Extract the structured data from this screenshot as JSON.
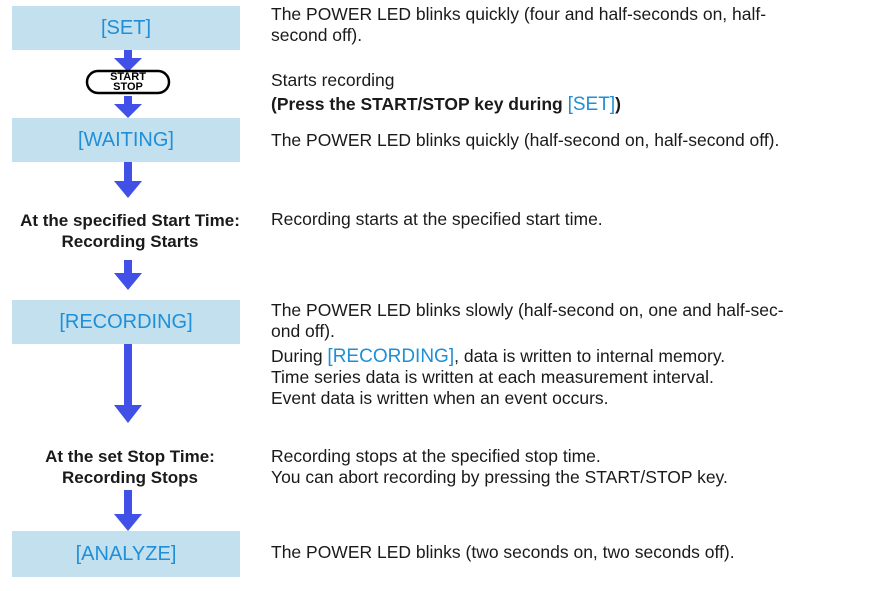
{
  "states": {
    "set": "[SET]",
    "waiting": "[WAITING]",
    "recording": "[RECORDING]",
    "analyze": "[ANALYZE]"
  },
  "key": {
    "line1": "START",
    "line2": "STOP"
  },
  "labels": {
    "start_line1": "At the specified Start Time:",
    "start_line2": "Recording Starts",
    "stop_line1": "At the set Stop Time:",
    "stop_line2": "Recording Stops"
  },
  "descriptions": {
    "set_line1": "The POWER LED blinks quickly (four and half-seconds on, half-",
    "set_line2": "second off).",
    "key_line1": "Starts recording",
    "key_line2_pre": "(Press the START/STOP key during ",
    "key_line2_hl": "[SET]",
    "key_line2_post": ")",
    "waiting": "The POWER LED blinks quickly (half-second on, half-second off).",
    "start": "Recording starts at the specified start time.",
    "recording_line1": "The POWER LED blinks slowly (half-second on, one and half-sec-",
    "recording_line2": "ond off).",
    "recording_line3_pre": "During ",
    "recording_line3_hl": "[RECORDING]",
    "recording_line3_post": ", data is written to internal memory.",
    "recording_line4": "Time series data is written at each measurement interval.",
    "recording_line5": "Event data is written when an event occurs.",
    "stop_line1": "Recording stops at the specified stop time.",
    "stop_line2": "You can abort recording by pressing the START/STOP key.",
    "analyze": "The POWER LED blinks (two seconds on, two seconds off)."
  },
  "colors": {
    "accent": "#1e8fd8",
    "state_bg": "#c3e0ee",
    "arrow": "#4150e6"
  }
}
